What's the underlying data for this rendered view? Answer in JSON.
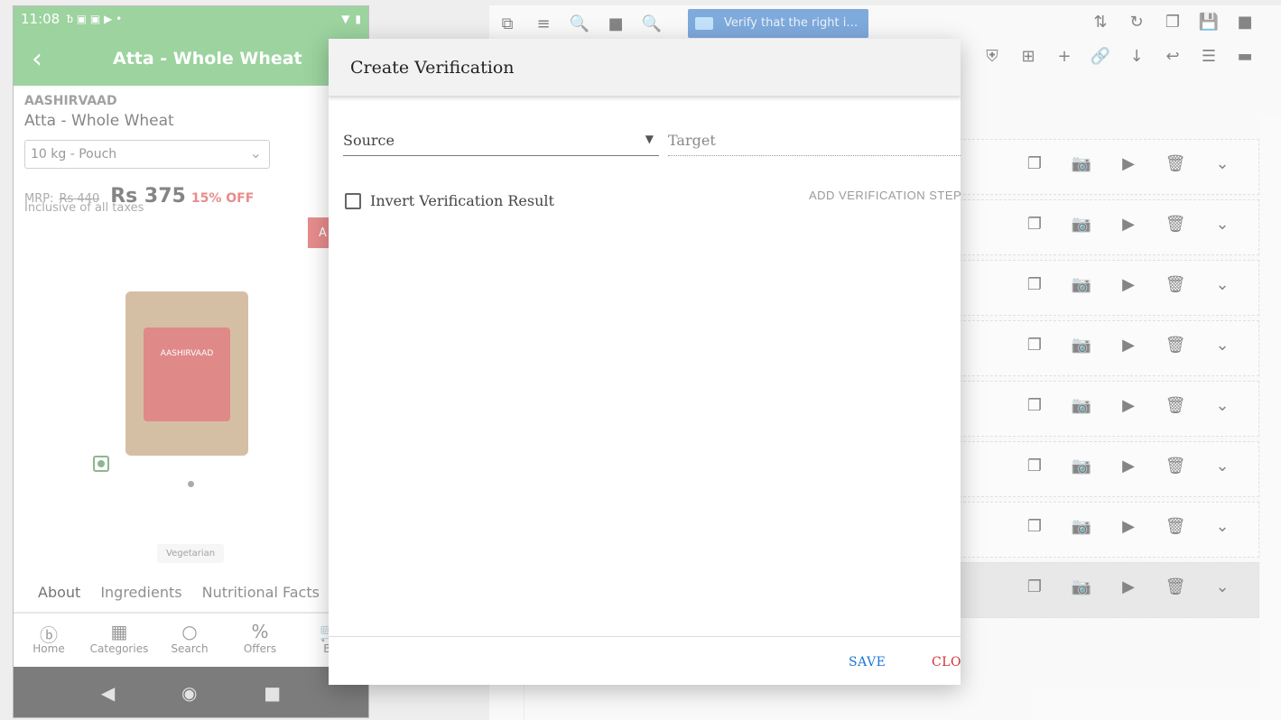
{
  "phone": {
    "status_time": "11:08",
    "app_title": "Atta - Whole Wheat",
    "brand": "AASHIRVAAD",
    "product_name": "Atta - Whole Wheat",
    "pack_size": "10 kg - Pouch",
    "mrp_label": "MRP:",
    "mrp_value": "Rs 440",
    "price": "Rs 375",
    "discount": "15% OFF",
    "taxes_note": "Inclusive of all taxes",
    "add_button_partial": "A",
    "veg_tag": "Vegetarian",
    "tabs": [
      "About",
      "Ingredients",
      "Nutritional Facts"
    ],
    "bottom_nav": [
      "Home",
      "Categories",
      "Search",
      "Offers",
      "Ba"
    ]
  },
  "ide": {
    "test_label": "Verify that the right i…",
    "accent_color": "#1565c0",
    "step_count": 8,
    "selected_step_index": 7
  },
  "dialog": {
    "title": "Create Verification",
    "source_placeholder": "Source",
    "target_placeholder": "Target",
    "invert_label": "Invert Verification Result",
    "add_step_label": "ADD VERIFICATION STEP",
    "save_label": "SAVE",
    "close_label": "CLOSE"
  }
}
